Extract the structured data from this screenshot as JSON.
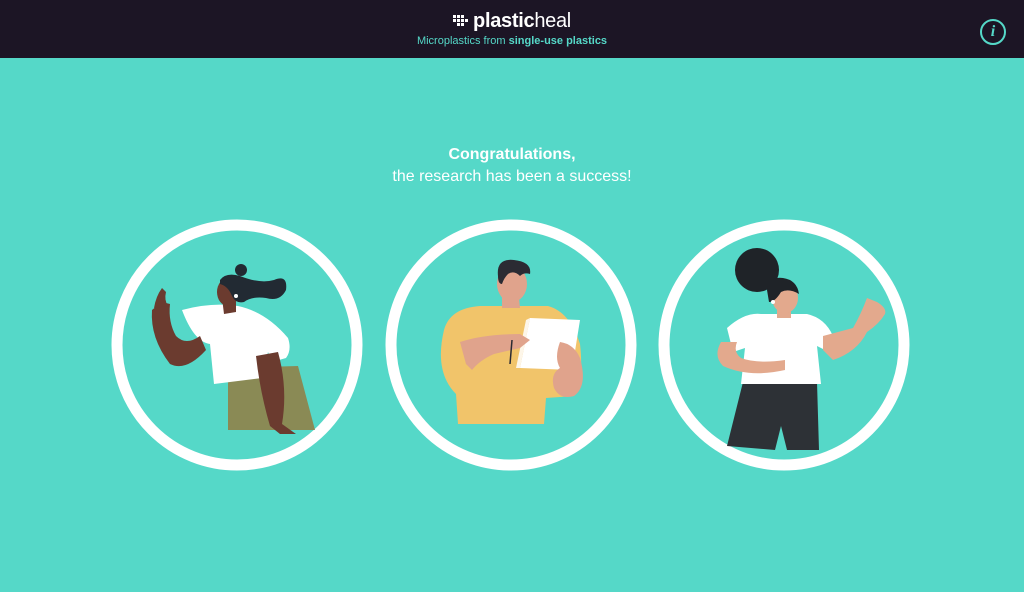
{
  "header": {
    "logo_bold": "plastic",
    "logo_light": "heal",
    "subtitle_prefix": "Microplastics from ",
    "subtitle_highlight": "single-use plastics",
    "info_icon": "i"
  },
  "main": {
    "title": "Congratulations,",
    "subtitle": "the research has been a success!"
  },
  "icons": {
    "logo": "plasticheal-logo-icon",
    "info": "info-icon"
  },
  "colors": {
    "background": "#55d8c8",
    "topbar": "#1c1525",
    "accent": "#55d8c8",
    "white": "#ffffff"
  }
}
